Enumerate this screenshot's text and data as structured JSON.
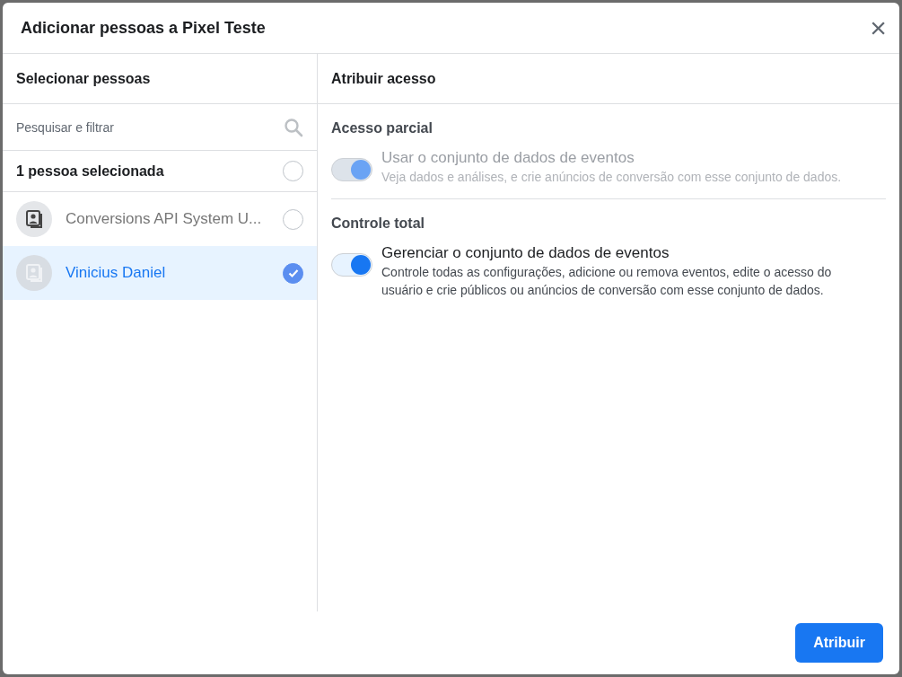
{
  "dialog": {
    "title": "Adicionar pessoas a Pixel Teste",
    "close": "×"
  },
  "people_panel": {
    "heading": "Selecionar pessoas",
    "search": {
      "placeholder": "Pesquisar e filtrar"
    },
    "summary": {
      "label": "1 pessoa selecionada",
      "checked": false
    },
    "people": [
      {
        "name": "Conversions API System U...",
        "selected": false
      },
      {
        "name": "Vinicius Daniel",
        "selected": true
      }
    ]
  },
  "access_panel": {
    "heading": "Atribuir acesso",
    "sections": [
      {
        "title": "Acesso parcial",
        "option": {
          "label": "Usar o conjunto de dados de eventos",
          "description": "Veja dados e análises, e crie anúncios de conversão com esse conjunto de dados.",
          "on": true,
          "disabled": true
        }
      },
      {
        "title": "Controle total",
        "option": {
          "label": "Gerenciar o conjunto de dados de eventos",
          "description": "Controle todas as configurações, adicione ou remova eventos, edite o acesso do usuário e crie públicos ou anúncios de conversão com esse conjunto de dados.",
          "on": true,
          "disabled": false
        }
      }
    ]
  },
  "buttons": [
    {
      "label": "Atribuir"
    }
  ]
}
